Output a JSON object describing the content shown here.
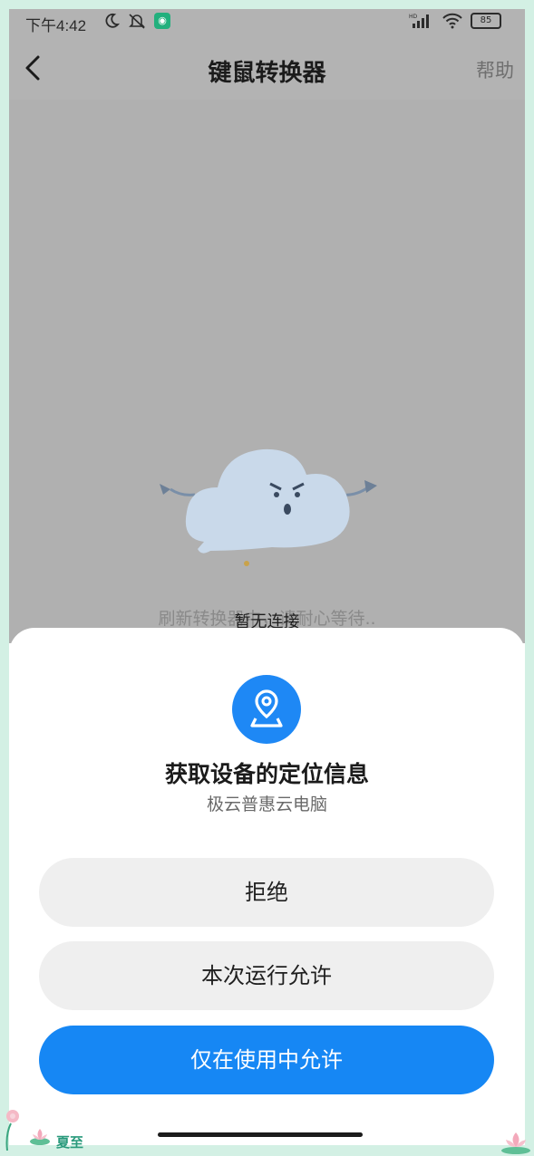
{
  "status_bar": {
    "time": "下午4:42",
    "battery": "85",
    "network": "HD"
  },
  "app_bar": {
    "title": "键鼠转换器",
    "help_label": "帮助"
  },
  "content": {
    "message_back": "刷新转换器中，请耐心等待..",
    "message_front": "暂无连接"
  },
  "permission_sheet": {
    "icon": "location-pin-icon",
    "title": "获取设备的定位信息",
    "app_name": "极云普惠云电脑",
    "deny_label": "拒绝",
    "allow_once_label": "本次运行允许",
    "allow_while_using_label": "仅在使用中允许",
    "accent_color": "#1687f4"
  },
  "decoration": {
    "label": "夏至"
  }
}
